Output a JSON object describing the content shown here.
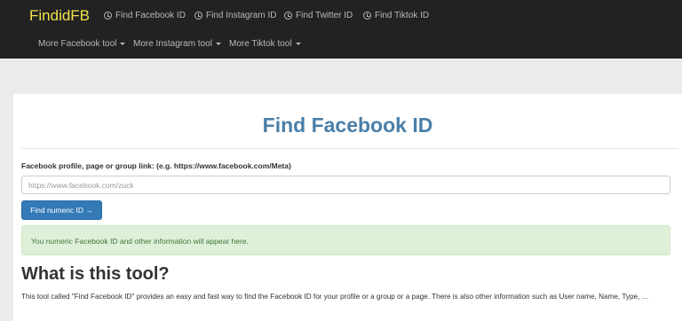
{
  "brand": "FindidFB",
  "nav": {
    "links": [
      "Find Facebook ID",
      "Find Instagram ID",
      "Find Twitter ID",
      "Find Tiktok ID"
    ],
    "dropdowns": [
      "More Facebook tool",
      "More Instagram tool",
      "More Tiktok tool"
    ]
  },
  "main": {
    "title": "Find Facebook ID",
    "field_label": "Facebook profile, page or group link: (e.g. https://www.facebook.com/Meta)",
    "input_value": "",
    "input_placeholder": "https://www.facebook.com/zuck",
    "button_label": "Find numeric ID →",
    "alert_text": "You numeric Facebook ID and other information will appear here.",
    "section_heading": "What is this tool?",
    "description": "This tool called \"Find Facebook ID\" provides an easy and fast way to find the Facebook ID for your profile or a group or a page. There is also other information such as User name, Name, Type, …"
  },
  "colors": {
    "navbar_bg": "#222222",
    "brand": "#f2e24c",
    "title": "#4a7fa8",
    "button_bg": "#337ab7",
    "alert_bg": "#dff0d8",
    "alert_text": "#3c763d"
  },
  "icons": {
    "nav_link_icon": "clock-icon",
    "dropdown_icon": "caret-down-icon"
  }
}
